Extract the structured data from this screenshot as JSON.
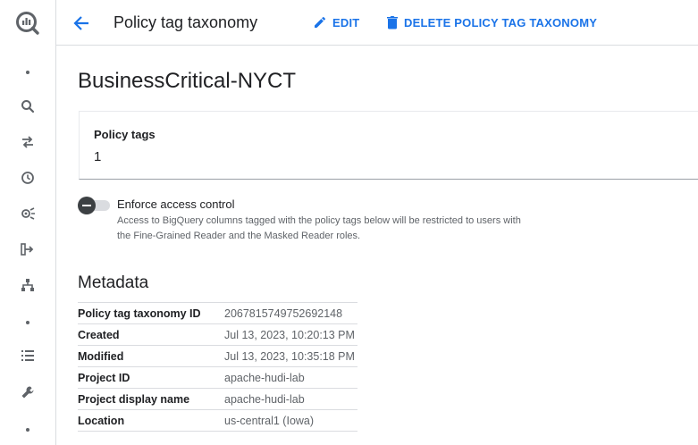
{
  "header": {
    "title": "Policy tag taxonomy",
    "edit_label": "EDIT",
    "delete_label": "DELETE POLICY TAG TAXONOMY"
  },
  "taxonomy": {
    "name": "BusinessCritical-NYCT"
  },
  "policy_tags_card": {
    "label": "Policy tags",
    "value": "1"
  },
  "enforce_access": {
    "label": "Enforce access control",
    "description": "Access to BigQuery columns tagged with the policy tags below will be restricted to users with the Fine-Grained Reader and the Masked Reader roles."
  },
  "metadata": {
    "title": "Metadata",
    "rows": [
      {
        "key": "Policy tag taxonomy ID",
        "value": "2067815749752692148"
      },
      {
        "key": "Created",
        "value": "Jul 13, 2023, 10:20:13 PM"
      },
      {
        "key": "Modified",
        "value": "Jul 13, 2023, 10:35:18 PM"
      },
      {
        "key": "Project ID",
        "value": "apache-hudi-lab"
      },
      {
        "key": "Project display name",
        "value": "apache-hudi-lab"
      },
      {
        "key": "Location",
        "value": "us-central1 (Iowa)"
      }
    ]
  },
  "rail_icons": [
    "bigquery-logo",
    "dot",
    "search-icon",
    "transfer-icon",
    "history-icon",
    "analytics-hub-icon",
    "pipeline-icon",
    "hierarchy-icon",
    "dot",
    "list-icon",
    "wrench-icon",
    "dot"
  ],
  "colors": {
    "accent": "#1a73e8",
    "text": "#202124",
    "muted": "#5f6368",
    "divider": "#dadce0"
  }
}
